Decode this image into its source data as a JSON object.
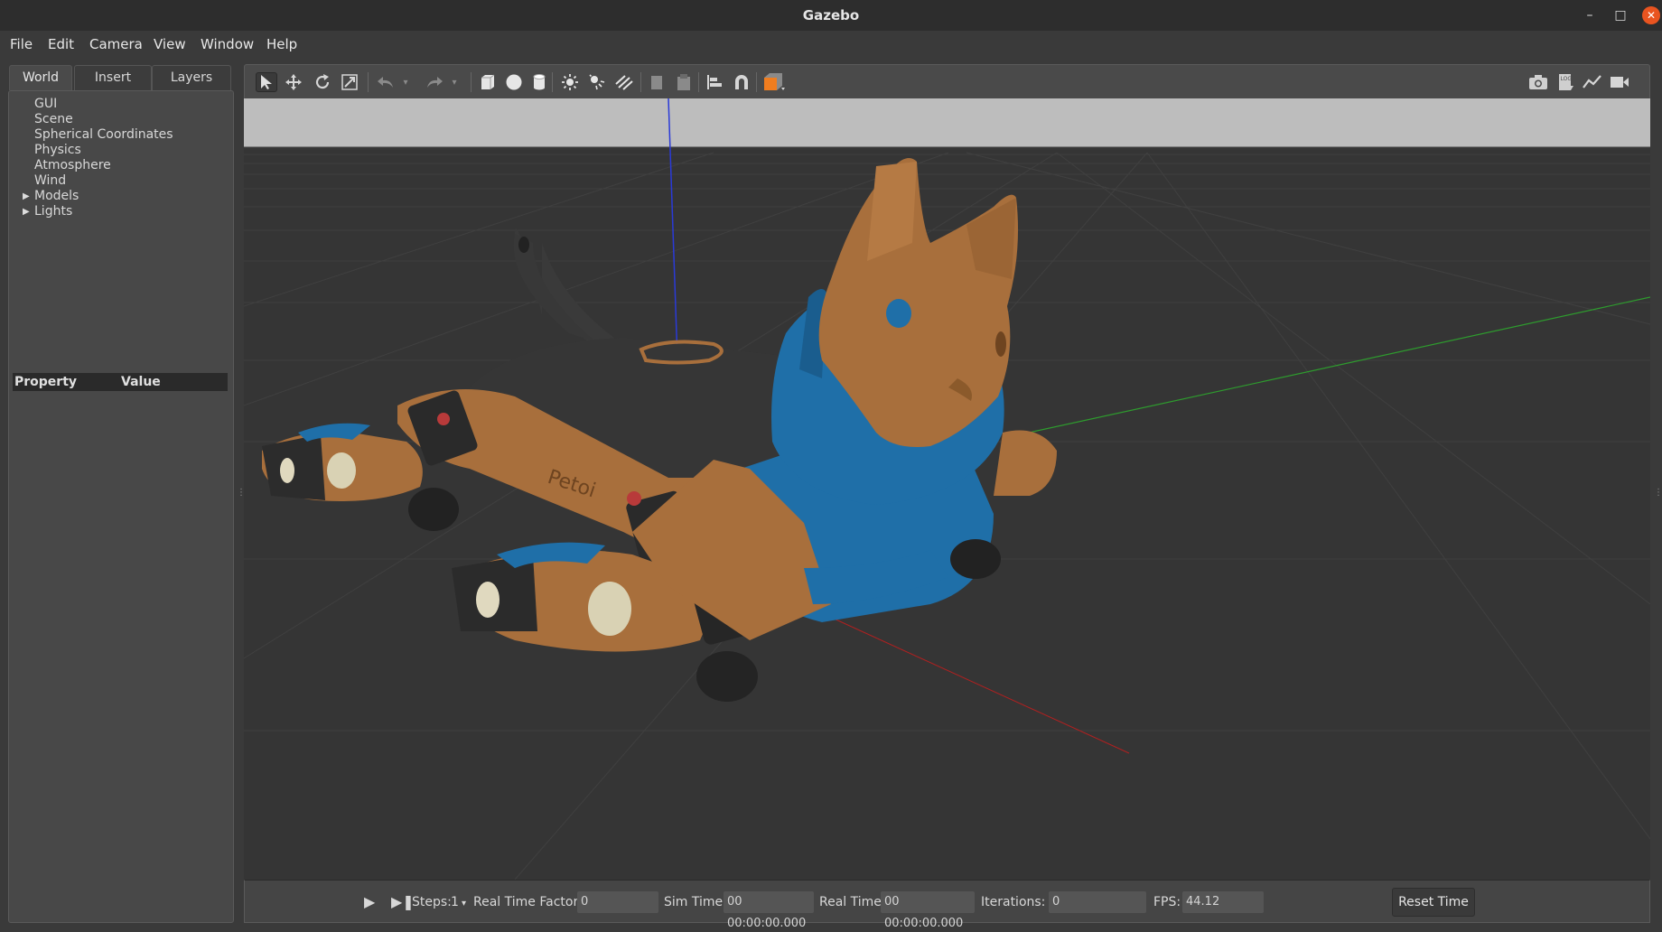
{
  "window": {
    "title": "Gazebo"
  },
  "menu": [
    "File",
    "Edit",
    "Camera",
    "View",
    "Window",
    "Help"
  ],
  "left_tabs": [
    "World",
    "Insert",
    "Layers"
  ],
  "tree": [
    {
      "label": "GUI",
      "expandable": false
    },
    {
      "label": "Scene",
      "expandable": false
    },
    {
      "label": "Spherical Coordinates",
      "expandable": false
    },
    {
      "label": "Physics",
      "expandable": false
    },
    {
      "label": "Atmosphere",
      "expandable": false
    },
    {
      "label": "Wind",
      "expandable": false
    },
    {
      "label": "Models",
      "expandable": true
    },
    {
      "label": "Lights",
      "expandable": true
    }
  ],
  "properties": {
    "col_property": "Property",
    "col_value": "Value"
  },
  "toolbar_icons": [
    "select-arrow-icon",
    "translate-icon",
    "rotate-icon",
    "scale-icon",
    "undo-icon",
    "redo-icon",
    "box-icon",
    "sphere-icon",
    "cylinder-icon",
    "point-light-icon",
    "spot-light-icon",
    "directional-light-icon",
    "copy-icon",
    "paste-icon",
    "align-icon",
    "snap-icon",
    "view-angle-icon",
    "screenshot-icon",
    "log-icon",
    "plot-icon",
    "record-icon"
  ],
  "model": {
    "logo_text": "Petoi"
  },
  "bottom": {
    "steps_label": "Steps:",
    "steps_value": "1",
    "rtf_label": "Real Time Factor:",
    "rtf_value": "0",
    "sim_label": "Sim Time:",
    "sim_value": "00 00:00:00.000",
    "real_label": "Real Time:",
    "real_value": "00 00:00:00.000",
    "iter_label": "Iterations:",
    "iter_value": "0",
    "fps_label": "FPS:",
    "fps_value": "44.12",
    "reset_label": "Reset Time"
  },
  "colors": {
    "accent_close": "#e95420",
    "sky": "#bdbdbd",
    "ground": "#353535",
    "robot_tan": "#a86f3c",
    "robot_blue": "#1f6fa8"
  }
}
